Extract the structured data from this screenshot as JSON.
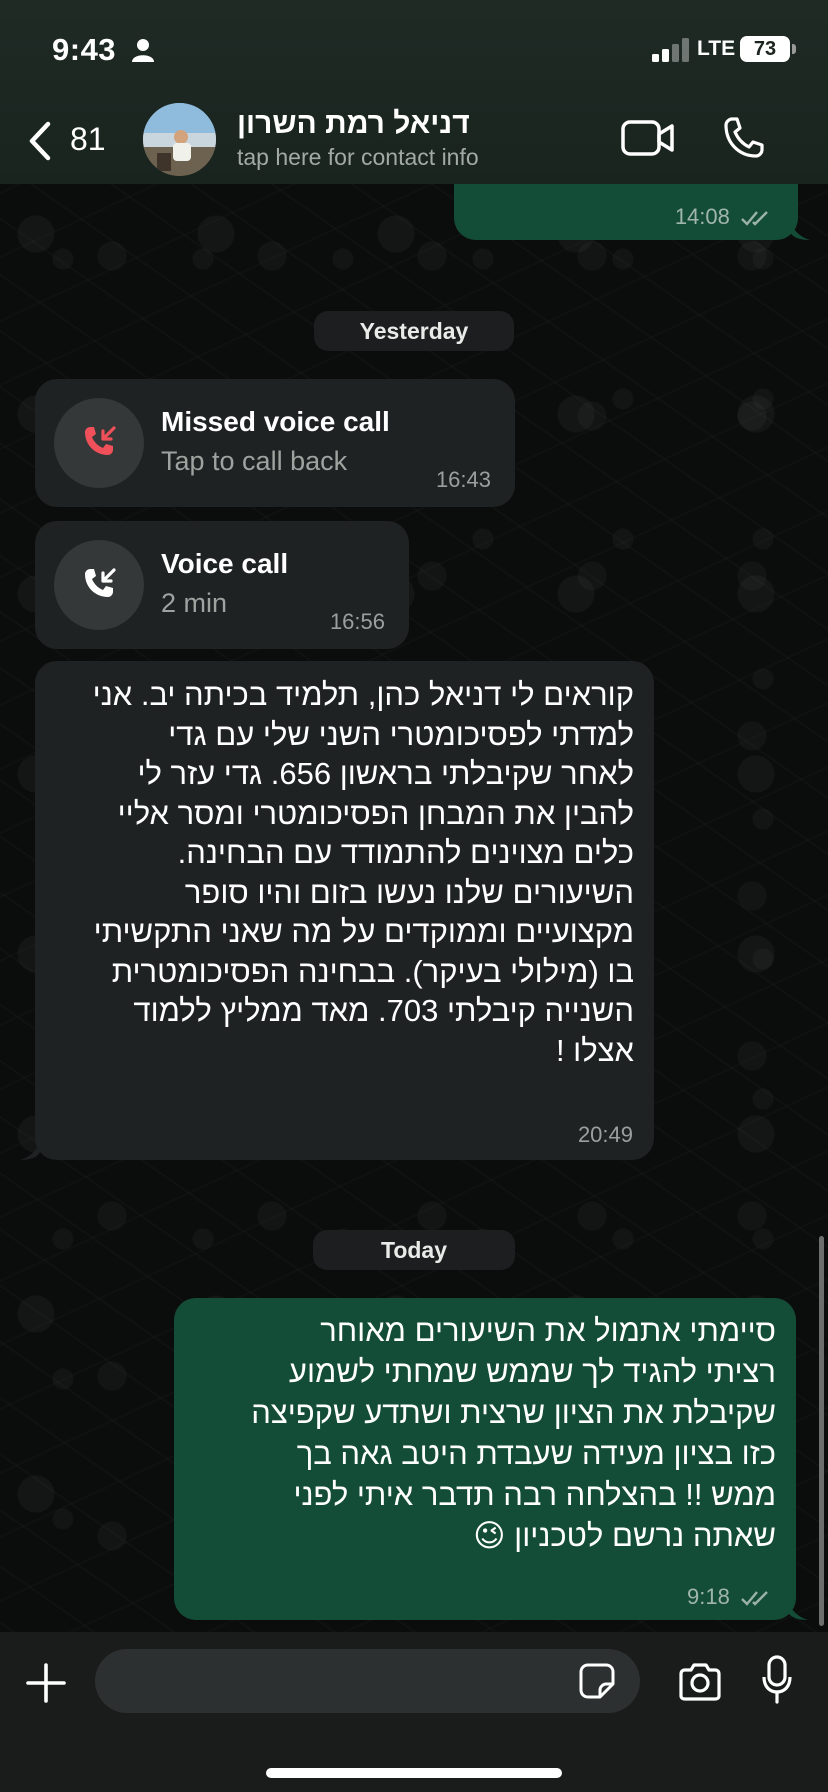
{
  "status_bar": {
    "time": "9:43",
    "network": "LTE",
    "battery": "73"
  },
  "header": {
    "back_count": "81",
    "contact_name": "דניאל רמת השרון",
    "contact_subtitle": "tap here for contact info",
    "icons": {
      "back": "chevron-left-icon",
      "video": "video-camera-icon",
      "call": "phone-icon"
    }
  },
  "messages": {
    "top_partial": {
      "time": "14:08"
    },
    "date_yesterday": "Yesterday",
    "missed_call": {
      "title": "Missed voice call",
      "subtitle": "Tap to call back",
      "time": "16:43"
    },
    "voice_call": {
      "title": "Voice call",
      "subtitle": "2 min",
      "time": "16:56"
    },
    "incoming_text": {
      "text": "קוראים לי דניאל כהן, תלמיד בכיתה יב. אני\nלמדתי לפסיכומטרי השני שלי עם גדי\nלאחר שקיבלתי בראשון 656. גדי עזר לי\nלהבין את המבחן הפסיכומטרי ומסר אליי\nכלים מצוינים להתמודד עם הבחינה.\nהשיעורים שלנו נעשו בזום והיו סופר\nמקצועיים וממוקדים על מה שאני התקשיתי\nבו (מילולי בעיקר). בבחינה הפסיכומטרית\nהשנייה קיבלתי 703. מאד ממליץ ללמוד\nאצלו !",
      "time": "20:49"
    },
    "date_today": "Today",
    "outgoing_text": {
      "text": "סיימתי אתמול את השיעורים מאוחר\nרציתי להגיד לך שממש שמחתי לשמוע\nשקיבלת את הציון שרצית ושתדע שקפיצה\nכזו בציון מעידה שעבדת היטב גאה בך\nממש !! בהצלחה רבה תדבר איתי לפני\nשאתה נרשם לטכניון 😉",
      "time": "9:18"
    }
  },
  "input_bar": {
    "icons": {
      "add": "plus-icon",
      "sticker": "sticker-icon",
      "camera": "camera-icon",
      "mic": "microphone-icon"
    }
  },
  "colors": {
    "outgoing_bubble": "#144d37",
    "incoming_bubble": "#1f2223",
    "missed_call_red": "#f0505a"
  }
}
